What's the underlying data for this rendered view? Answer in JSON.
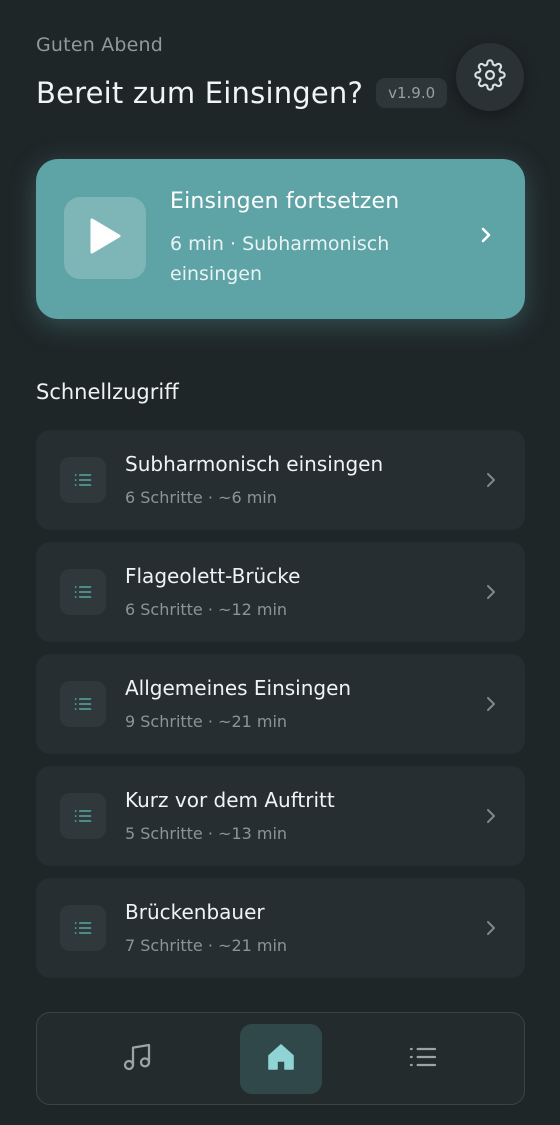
{
  "header": {
    "greeting": "Guten Abend",
    "title": "Bereit zum Einsingen?",
    "version": "v1.9.0",
    "settings_icon": "gear-icon"
  },
  "hero": {
    "title": "Einsingen fortsetzen",
    "subtitle": "6 min · Subharmonisch einsingen",
    "play_icon": "play-icon",
    "chevron_icon": "chevron-right-icon"
  },
  "quick_access": {
    "heading": "Schnellzugriff",
    "items": [
      {
        "title": "Subharmonisch einsingen",
        "meta": "6 Schritte · ~6 min"
      },
      {
        "title": "Flageolett-Brücke",
        "meta": "6 Schritte · ~12 min"
      },
      {
        "title": "Allgemeines Einsingen",
        "meta": "9 Schritte · ~21 min"
      },
      {
        "title": "Kurz vor dem Auftritt",
        "meta": "5 Schritte · ~13 min"
      },
      {
        "title": "Brückenbauer",
        "meta": "7 Schritte · ~21 min"
      }
    ]
  },
  "nav": {
    "items": [
      {
        "icon": "music-note-icon",
        "active": false
      },
      {
        "icon": "home-icon",
        "active": true
      },
      {
        "icon": "list-icon",
        "active": false
      }
    ]
  },
  "colors": {
    "background": "#1f2628",
    "accent": "#5ea3a6",
    "card": "#262e31",
    "icon_teal": "#5fa6a8"
  }
}
